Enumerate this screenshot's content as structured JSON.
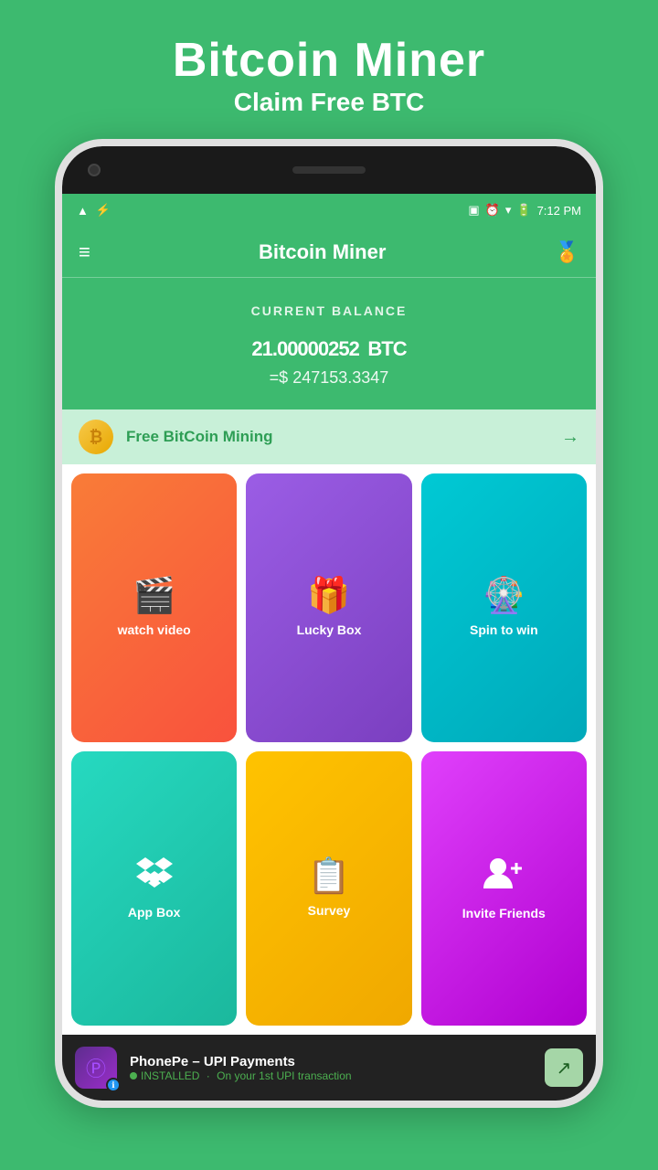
{
  "page": {
    "background_color": "#3dba6f",
    "header": {
      "title": "Bitcoin Miner",
      "subtitle": "Claim Free BTC"
    }
  },
  "status_bar": {
    "time": "7:12 PM",
    "signal": "▲",
    "usb": "⚡",
    "battery_icon": "🔋"
  },
  "app_bar": {
    "title": "Bitcoin Miner",
    "menu_icon": "≡",
    "award_icon": "🏅"
  },
  "balance": {
    "label": "Current Balance",
    "amount": "21.00000252",
    "currency": "BTC",
    "usd_value": "=$ 247153.3347"
  },
  "mining_banner": {
    "coin_symbol": "₿",
    "text": "Free BitCoin Mining",
    "arrow": "→"
  },
  "actions": [
    {
      "id": "watch-video",
      "label": "watch video",
      "icon": "🎬",
      "style": "btn-watch"
    },
    {
      "id": "lucky-box",
      "label": "Lucky Box",
      "icon": "🎁",
      "style": "btn-lucky"
    },
    {
      "id": "spin-to-win",
      "label": "Spin to win",
      "icon": "🎡",
      "style": "btn-spin"
    },
    {
      "id": "app-box",
      "label": "App Box",
      "icon": "📦",
      "style": "btn-app"
    },
    {
      "id": "survey",
      "label": "Survey",
      "icon": "📋",
      "style": "btn-survey"
    },
    {
      "id": "invite",
      "label": "Invite Friends",
      "icon": "👤➕",
      "style": "btn-invite"
    }
  ],
  "ad": {
    "title": "PhonePe – UPI Payments",
    "subtitle": "On your 1st UPI transaction",
    "status": "INSTALLED",
    "action_icon": "↗"
  }
}
